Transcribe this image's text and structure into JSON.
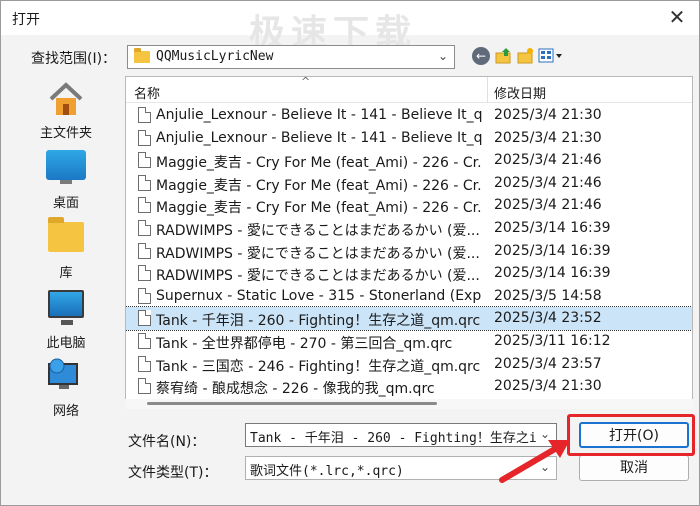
{
  "window": {
    "title": "打开",
    "watermark": "极速下载",
    "close_glyph": "✕"
  },
  "lookin": {
    "label": "查找范围(I)：",
    "value": "QQMusicLyricNew",
    "arrow": "⌄"
  },
  "toolbar": {
    "back_glyph": "←"
  },
  "sidebar": {
    "items": [
      {
        "label": "主文件夹",
        "icon": "home-icon"
      },
      {
        "label": "桌面",
        "icon": "desktop-icon"
      },
      {
        "label": "库",
        "icon": "library-icon"
      },
      {
        "label": "此电脑",
        "icon": "computer-icon"
      },
      {
        "label": "网络",
        "icon": "network-icon"
      }
    ]
  },
  "filelist": {
    "columns": {
      "name": "名称",
      "date": "修改日期",
      "sort_caret": "^"
    },
    "rows": [
      {
        "name": "Anjulie_Lexnour - Believe It - 141 - Believe It_q...",
        "date": "2025/3/4 21:30"
      },
      {
        "name": "Anjulie_Lexnour - Believe It - 141 - Believe It_q...",
        "date": "2025/3/4 21:30"
      },
      {
        "name": "Maggie_麦吉 - Cry For Me (feat_Ami) - 226 - Cr...",
        "date": "2025/3/4 21:46"
      },
      {
        "name": "Maggie_麦吉 - Cry For Me (feat_Ami) - 226 - Cr...",
        "date": "2025/3/4 21:46"
      },
      {
        "name": "Maggie_麦吉 - Cry For Me (feat_Ami) - 226 - Cr...",
        "date": "2025/3/4 21:46"
      },
      {
        "name": "RADWIMPS - 愛にできることはまだあるかい (爱...",
        "date": "2025/3/14 16:39"
      },
      {
        "name": "RADWIMPS - 愛にできることはまだあるかい (爱...",
        "date": "2025/3/14 16:39"
      },
      {
        "name": "RADWIMPS - 愛にできることはまだあるかい (爱...",
        "date": "2025/3/14 16:39"
      },
      {
        "name": "Supernux - Static Love - 315 - Stonerland (Expl...",
        "date": "2025/3/5 14:58"
      },
      {
        "name": "Tank - 千年泪 - 260 - Fighting！生存之道_qm.qrc",
        "date": "2025/3/4 23:52",
        "selected": true
      },
      {
        "name": "Tank - 全世界都停电 - 270 - 第三回合_qm.qrc",
        "date": "2025/3/11 16:12"
      },
      {
        "name": "Tank - 三国恋 - 246 - Fighting！生存之道_qm.qrc",
        "date": "2025/3/4 23:57"
      },
      {
        "name": "蔡宥绮 - 酿成想念 - 226 - 像我的我_qm.qrc",
        "date": "2025/3/4 21:30"
      }
    ]
  },
  "filename": {
    "label": "文件名(N)：",
    "value": "Tank - 千年泪 - 260 - Fighting！生存之i",
    "arrow": "⌄"
  },
  "filetype": {
    "label": "文件类型(T)：",
    "value": "歌词文件(*.lrc,*.qrc)",
    "arrow": "⌄"
  },
  "buttons": {
    "open": "打开(O)",
    "cancel": "取消"
  },
  "colors": {
    "highlight": "#e5252a",
    "selection": "#cce4f7",
    "accent": "#1a73d0"
  }
}
